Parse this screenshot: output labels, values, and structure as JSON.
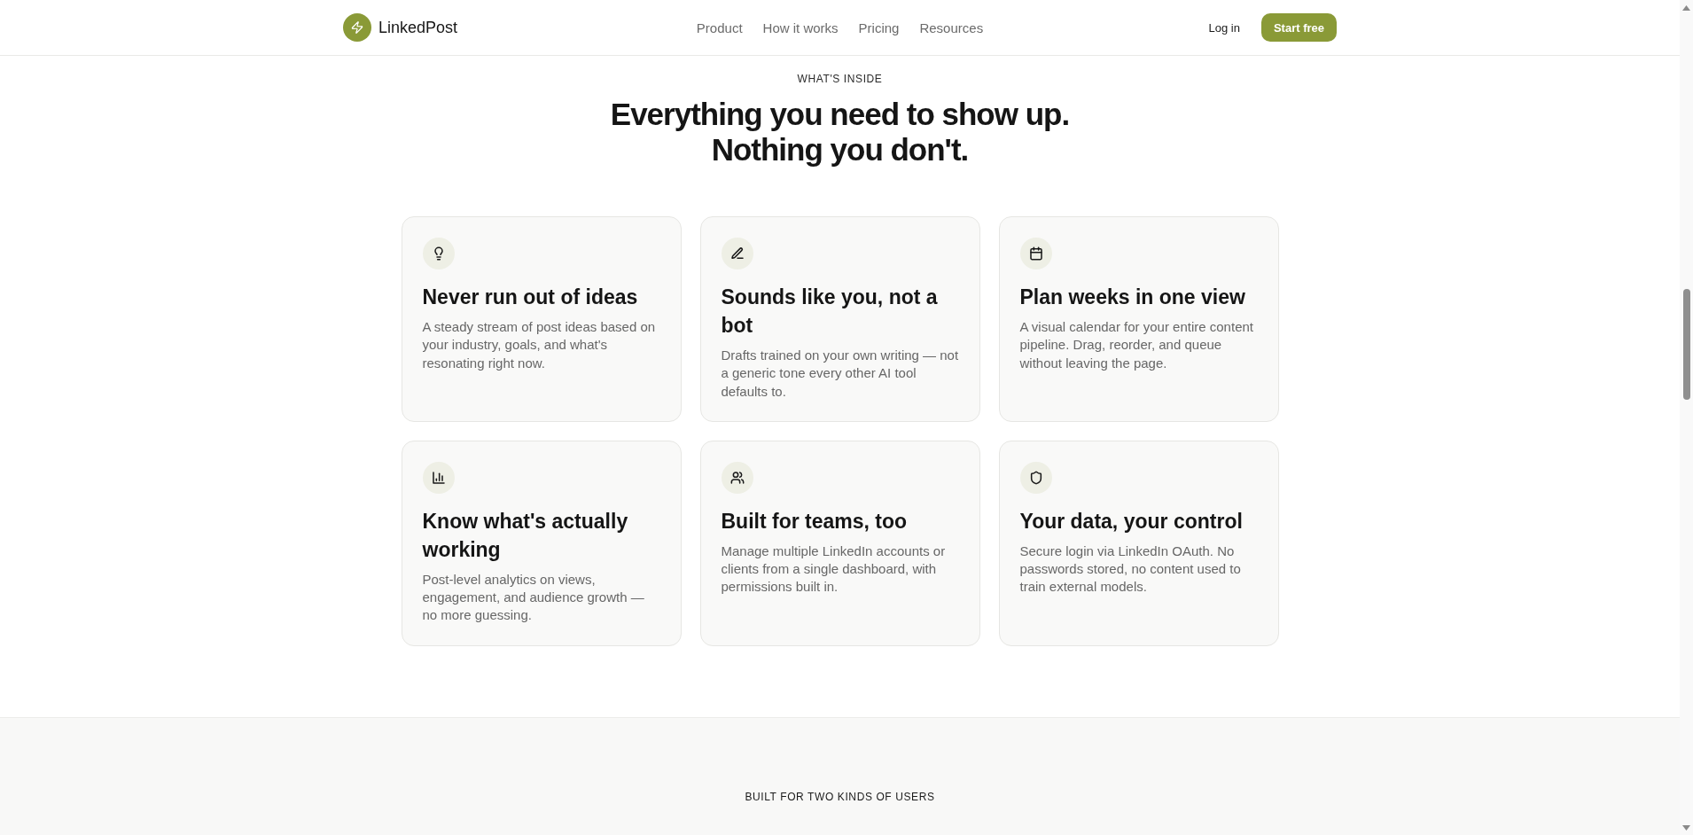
{
  "header": {
    "brand": "LinkedPost",
    "nav": [
      "Product",
      "How it works",
      "Pricing",
      "Resources"
    ],
    "login": "Log in",
    "cta": "Start free"
  },
  "features": {
    "eyebrow": "WHAT'S INSIDE",
    "heading": [
      "Everything you need to show up.",
      "Nothing you don't."
    ],
    "cards": [
      {
        "title": "Never run out of ideas",
        "text": "A steady stream of post ideas based on your industry, goals, and what's resonating right now."
      },
      {
        "title": "Sounds like you, not a bot",
        "text": "Drafts trained on your own writing — not a generic tone every other AI tool defaults to."
      },
      {
        "title": "Plan weeks in one view",
        "text": "A visual calendar for your entire content pipeline. Drag, reorder, and queue without leaving the page."
      },
      {
        "title": "Know what's actually working",
        "text": "Post-level analytics on views, engagement, and audience growth — no more guessing."
      },
      {
        "title": "Built for teams, too",
        "text": "Manage multiple LinkedIn accounts or clients from a single dashboard, with permissions built in."
      },
      {
        "title": "Your data, your control",
        "text": "Secure login via LinkedIn OAuth. No passwords stored, no content used to train external models."
      }
    ]
  },
  "users_section": {
    "eyebrow": "BUILT FOR TWO KINDS OF USERS"
  }
}
